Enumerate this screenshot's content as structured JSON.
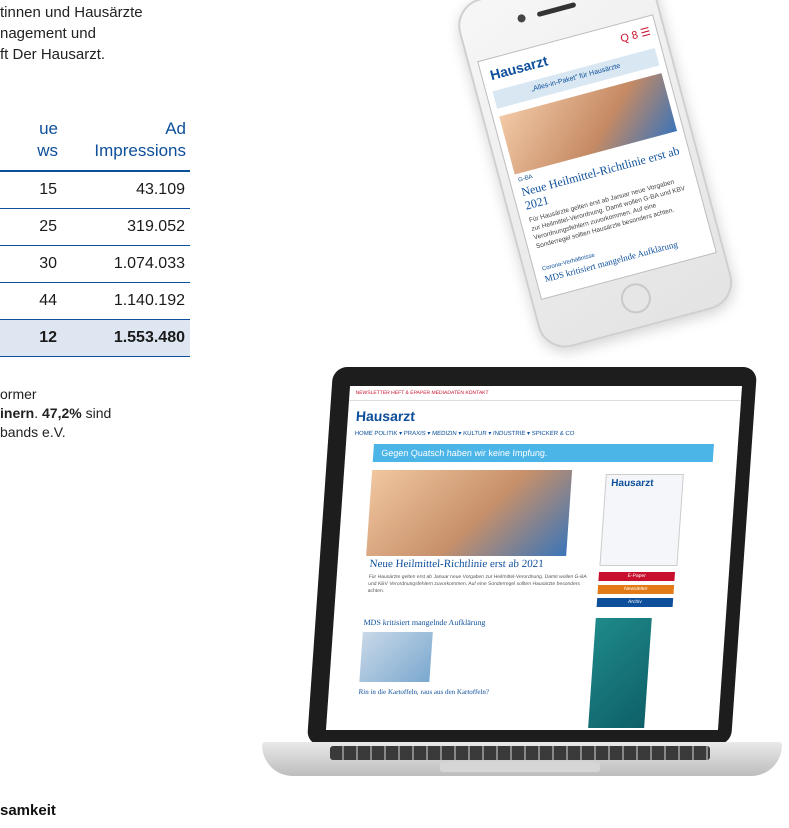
{
  "intro_lines": [
    "tinnen und Hausärzte",
    "nagement und",
    "ft Der Hausarzt."
  ],
  "table": {
    "headers": [
      [
        "ue",
        "ws"
      ],
      [
        "Ad",
        "Impressions"
      ]
    ],
    "rows": [
      [
        "15",
        "43.109"
      ],
      [
        "25",
        "319.052"
      ],
      [
        "30",
        "1.074.033"
      ],
      [
        "44",
        "1.140.192"
      ]
    ],
    "total": [
      "12",
      "1.553.480"
    ]
  },
  "note": {
    "line1": "ormer",
    "line2_bold": "inern",
    "line2_rest": ". ",
    "line2_pct": "47,2%",
    "line2_end": " sind",
    "line3": "bands e.V."
  },
  "footer_text": "samkeit",
  "phone": {
    "logo": "Hausarzt",
    "icons": "Q 8 ☰",
    "banner": "„Alles-in-Paket\" für Hausärzte",
    "kicker": "G-BA",
    "headline": "Neue Heilmittel-Richtlinie erst ab 2021",
    "text": "Für Hausärzte gelten erst ab Januar neue Vorgaben zur Heilmittel-Verordnung. Damit wollen G-BA und KBV Verordnungsfehlern zuvorkommen. Auf eine Sonderregel sollten Hausärzte besonders achten.",
    "kicker2": "Corona-Verhältnisse",
    "headline2": "MDS kritisiert mangelnde Aufklärung"
  },
  "laptop": {
    "top_bar": "NEWSLETTER   HEFT & EPAPER   MEDIADATEN   KONTAKT",
    "logo": "Hausarzt",
    "nav": "HOME   POLITIK ▾   PRAXIS ▾   MEDIZIN ▾   KULTUR ▾   INDUSTRIE ▾   SPICKER & CO",
    "ad": "Gegen Quatsch haben wir keine Impfung.",
    "headline": "Neue Heilmittel-Richtlinie erst ab 2021",
    "text": "Für Hausärzte gelten erst ab Januar neue Vorgaben zur Heilmittel-Verordnung. Damit wollen G-BA und KBV Verordnungsfehlern zuvorkommen. Auf eine Sonderregel sollten Hausärzte besonders achten.",
    "headline2": "MDS kritisiert mangelnde Aufklärung",
    "headline3": "Rin in die Kartoffeln, raus aus den Kartoffeln?",
    "side_title": "Hausarzt",
    "btn1": "E-Paper",
    "btn2": "Newsletter",
    "btn3": "Archiv"
  }
}
